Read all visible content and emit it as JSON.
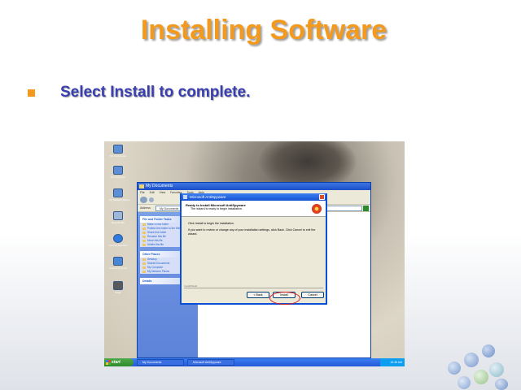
{
  "slide": {
    "title": "Installing Software",
    "bullet": "Select Install to complete.",
    "accent_color": "#f39a1e",
    "bullet_text_color": "#3a3fb0"
  },
  "desktop": {
    "icons": [
      "My Documents",
      "My Computer",
      "My Network Places",
      "Recycle Bin",
      "Internet Explorer",
      "Outlook Express",
      "Setup"
    ]
  },
  "explorer": {
    "title": "My Documents",
    "menu": [
      "File",
      "Edit",
      "View",
      "Favorites",
      "Tools",
      "Help"
    ],
    "address_label": "Address",
    "address_value": "My Documents",
    "tasks_panel": {
      "title": "File and Folder Tasks",
      "items": [
        "Make a new folder",
        "Publish this folder to the Web",
        "Share this folder",
        "Rename this file",
        "Move this file",
        "Delete this file"
      ]
    },
    "places_panel": {
      "title": "Other Places",
      "items": [
        "Desktop",
        "Shared Documents",
        "My Computer",
        "My Network Places"
      ]
    },
    "details_panel": {
      "title": "Details"
    }
  },
  "dialog": {
    "title": "Microsoft AntiSpyware",
    "header_title": "Ready to Install Microsoft AntiSpyware",
    "header_subtitle": "The wizard is ready to begin installation.",
    "body_line1": "Click Install to begin the installation.",
    "body_line2": "If you want to review or change any of your installation settings, click Back. Click Cancel to exit the wizard.",
    "brand": "InstallShield",
    "buttons": {
      "back": "< Back",
      "install": "Install",
      "cancel": "Cancel"
    }
  },
  "taskbar": {
    "start_label": "start",
    "tasks": [
      "My Documents",
      "Microsoft AntiSpyware"
    ],
    "clock": "10:45 AM"
  }
}
